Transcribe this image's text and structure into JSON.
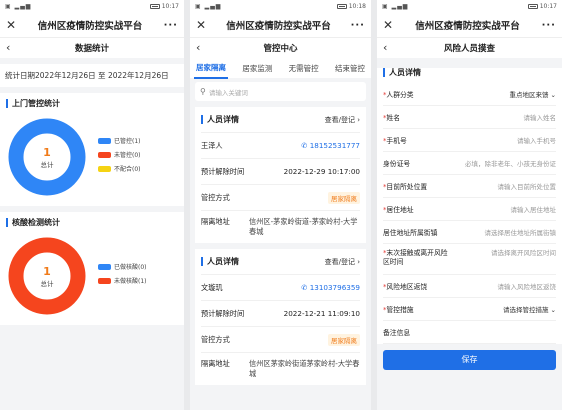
{
  "status": {
    "left": "▣ ▂▄▆",
    "p1_time": "10:17",
    "p2_time": "10:18",
    "p3_time": "10:17"
  },
  "app": {
    "title": "信州区疫情防控实战平台",
    "close": "✕",
    "more": "···",
    "back": "‹"
  },
  "stats": {
    "page_title": "数据统计",
    "date_text": "统计日期2022年12月26日 至 2022年12月26日",
    "visit": {
      "title": "上门管控统计",
      "center_value": "1",
      "center_label": "总计",
      "legend": [
        {
          "label": "已管控(1)",
          "color": "#2f86f6"
        },
        {
          "label": "未管控(0)",
          "color": "#f5451e"
        },
        {
          "label": "不配合(0)",
          "color": "#f5d313"
        }
      ],
      "chart_data": {
        "type": "pie",
        "title": "",
        "categories": [
          "已管控",
          "未管控",
          "不配合"
        ],
        "values": [
          1,
          0,
          0
        ],
        "total": 1
      }
    },
    "nucleic": {
      "title": "核酸检测统计",
      "center_value": "1",
      "center_label": "总计",
      "legend": [
        {
          "label": "已做核酸(0)",
          "color": "#2f86f6"
        },
        {
          "label": "未做核酸(1)",
          "color": "#f5451e"
        }
      ],
      "chart_data": {
        "type": "pie",
        "title": "",
        "categories": [
          "已做核酸",
          "未做核酸"
        ],
        "values": [
          0,
          1
        ],
        "total": 1
      }
    }
  },
  "control": {
    "page_title": "管控中心",
    "tabs": [
      "居家隔离",
      "居家监测",
      "无需管控",
      "结束管控"
    ],
    "active_tab": 0,
    "search_placeholder": "请输入关键词",
    "cards": [
      {
        "header": "人员详情",
        "action": "查看/登记 ›",
        "name": "王泽人",
        "phone": "18152531777",
        "release_label": "预计解除时间",
        "release_time": "2022-12-29 10:17:00",
        "mode_label": "管控方式",
        "mode": "居家隔离",
        "addr_label": "隔离地址",
        "addr": "信州区-茅家岭街道-茅家岭村-大学春城"
      },
      {
        "header": "人员详情",
        "action": "查看/登记 ›",
        "name": "文璇玑",
        "phone": "13103796359",
        "release_label": "预计解除时间",
        "release_time": "2022-12-21 11:09:10",
        "mode_label": "管控方式",
        "mode": "居家隔离",
        "addr_label": "隔离地址",
        "addr": "信州区茅家岭街道茅家岭村-大学春城"
      }
    ]
  },
  "report": {
    "page_title": "风险人员摸查",
    "section": "人员详情",
    "fields": [
      {
        "label": "人群分类",
        "required": true,
        "value": "重点地区来馈",
        "is_select": true
      },
      {
        "label": "姓名",
        "required": true,
        "value": "请输入姓名"
      },
      {
        "label": "手机号",
        "required": true,
        "value": "请输入手机号"
      },
      {
        "label": "身份证号",
        "required": false,
        "value": "必填，除非老年、小孩无身份证"
      },
      {
        "label": "目前所处位置",
        "required": true,
        "value": "请输入目前所处位置"
      },
      {
        "label": "居住地址",
        "required": true,
        "value": "请输入居住地址"
      },
      {
        "label": "居住地址所属街镇",
        "required": false,
        "value": "请选择居住地址所属街镇"
      },
      {
        "label": "末次接触或离开风险区时间",
        "required": true,
        "value": "请选择离开风险区时间",
        "tall": true
      },
      {
        "label": "风险地区返饶",
        "required": true,
        "value": "请输入风险地区返饶"
      },
      {
        "label": "管控措施",
        "required": true,
        "value": "请选择管控措施",
        "is_select": true
      },
      {
        "label": "备注信息",
        "required": false,
        "value": ""
      }
    ],
    "save": "保存"
  }
}
